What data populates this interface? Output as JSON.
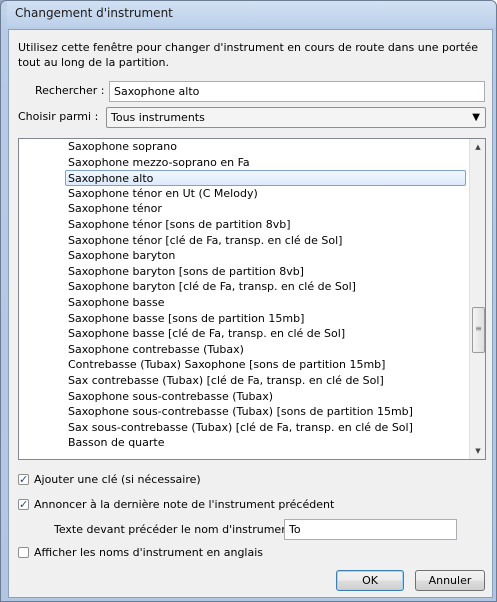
{
  "window": {
    "title": "Changement d'instrument"
  },
  "intro_text": "Utilisez cette fenêtre pour changer d'instrument en cours de route dans une portée tout au long de la partition.",
  "search": {
    "label": "Rechercher :",
    "value": "Saxophone alto"
  },
  "choose": {
    "label": "Choisir parmi :",
    "value": "Tous instruments"
  },
  "instruments": {
    "selected_index": 2,
    "items": [
      "Saxophone soprano",
      "Saxophone mezzo-soprano en Fa",
      "Saxophone alto",
      "Saxophone ténor en Ut (C Melody)",
      "Saxophone ténor",
      "Saxophone ténor [sons de partition 8vb]",
      "Saxophone ténor [clé de Fa, transp. en clé de Sol]",
      "Saxophone baryton",
      "Saxophone baryton [sons de partition 8vb]",
      "Saxophone baryton [clé de Fa, transp. en clé de Sol]",
      "Saxophone basse",
      "Saxophone basse [sons de partition 15mb]",
      "Saxophone basse [clé de Fa, transp. en clé de Sol]",
      "Saxophone contrebasse (Tubax)",
      "Contrebasse (Tubax) Saxophone [sons de partition 15mb]",
      "Sax contrebasse (Tubax) [clé de Fa, transp. en clé de Sol]",
      "Saxophone sous-contrebasse (Tubax)",
      "Saxophone sous-contrebasse (Tubax) [sons de partition 15mb]",
      "Sax sous-contrebasse (Tubax) [clé de Fa, transp. en clé de Sol]",
      "Basson de quarte"
    ]
  },
  "options": {
    "add_clef": {
      "label": "Ajouter une clé (si nécessaire)",
      "checked": true
    },
    "announce": {
      "label": "Annoncer à la dernière note de l'instrument précédent",
      "checked": true
    },
    "prefix": {
      "label": "Texte devant précéder le nom d'instrument :",
      "value": "To"
    },
    "english_names": {
      "label": "Afficher les noms d'instrument en anglais",
      "checked": false
    }
  },
  "buttons": {
    "ok": "OK",
    "cancel": "Annuler"
  },
  "icons": {
    "scroll_up": "scroll-up-arrow-icon",
    "scroll_down": "scroll-down-arrow-icon",
    "dropdown": "chevron-down-icon"
  }
}
